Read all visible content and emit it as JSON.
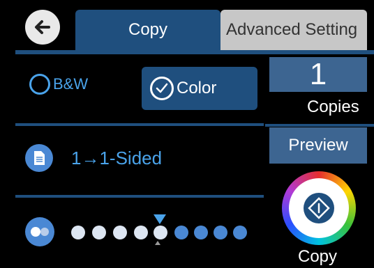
{
  "header": {
    "back_icon": "arrow-left-icon",
    "tabs": [
      {
        "label": "Copy",
        "active": true
      },
      {
        "label": "Advanced Setting",
        "active": false
      }
    ]
  },
  "color_mode": {
    "options": [
      {
        "label": "B&W",
        "selected": false
      },
      {
        "label": "Color",
        "selected": true
      }
    ]
  },
  "sided": {
    "icon": "document-icon",
    "label": "1→1-Sided"
  },
  "density": {
    "icon": "density-icon",
    "level": 0,
    "min": -4,
    "max": 4
  },
  "copies": {
    "value": "1",
    "label": "Copies"
  },
  "preview": {
    "label": "Preview"
  },
  "start": {
    "icon": "start-diamond-icon",
    "label": "Copy"
  },
  "colors": {
    "accent": "#1f4f7e",
    "text_blue": "#4aa3ea",
    "button": "#3d6591"
  }
}
